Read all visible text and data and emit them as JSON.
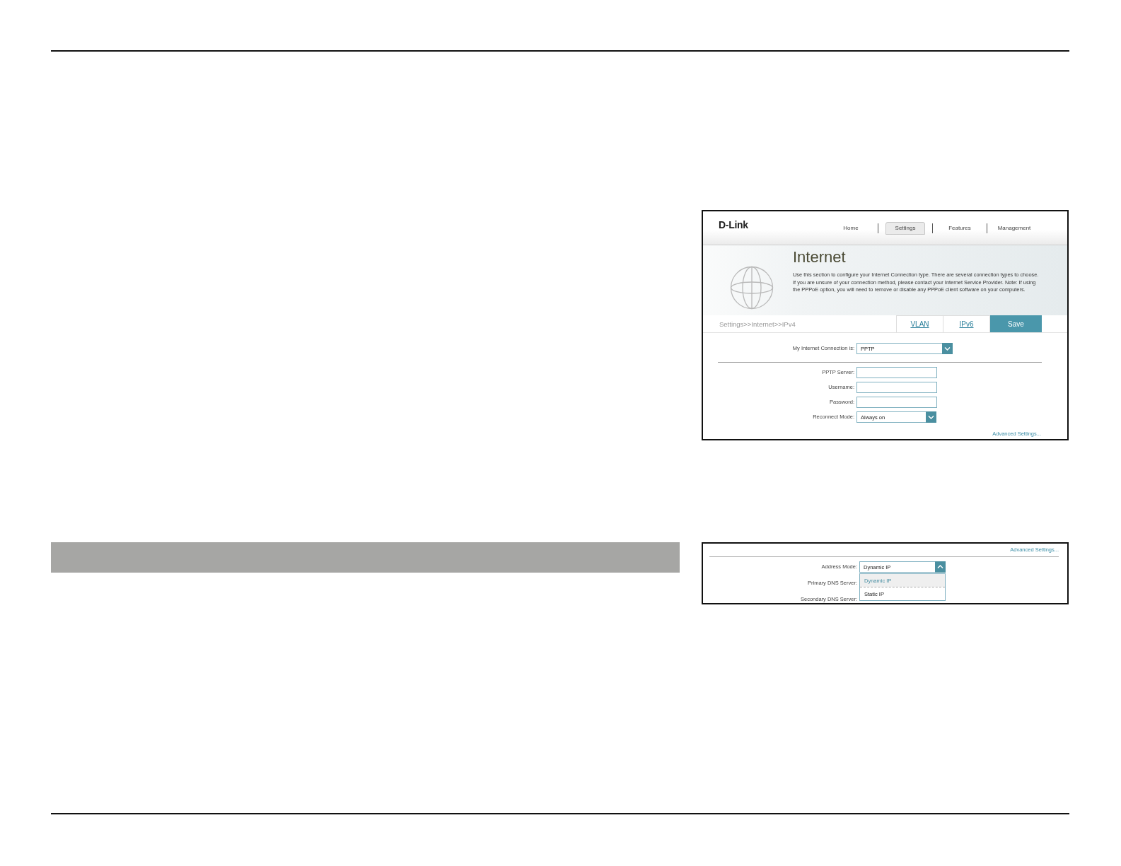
{
  "main_screenshot": {
    "logo": "D-Link",
    "nav": [
      {
        "label": "Home",
        "selected": false
      },
      {
        "label": "Settings",
        "selected": true
      },
      {
        "label": "Features",
        "selected": false
      },
      {
        "label": "Management",
        "selected": false
      }
    ],
    "hero": {
      "title": "Internet",
      "description": "Use this section to configure your Internet Connection type. There are several connection types to choose. If you are unsure of your connection method, please contact your Internet Service Provider. Note: If using the PPPoE option, you will need to remove or disable any PPPoE client software on your computers."
    },
    "breadcrumb": "Settings>>Internet>>IPv4",
    "tabs": [
      {
        "label": "VLAN",
        "kind": "link"
      },
      {
        "label": "IPv6",
        "kind": "link"
      },
      {
        "label": "Save",
        "kind": "button"
      }
    ],
    "connection": {
      "label": "My Internet Connection is:",
      "value": "PPTP"
    },
    "fields": [
      {
        "kind": "text",
        "label": "PPTP Server:"
      },
      {
        "kind": "text",
        "label": "Username:"
      },
      {
        "kind": "text",
        "label": "Password:"
      },
      {
        "kind": "select",
        "label": "Reconnect Mode:",
        "value": "Always on"
      }
    ],
    "advanced_link": "Advanced Settings..."
  },
  "dropdown_screenshot": {
    "advanced_link": "Advanced Settings...",
    "address_mode": {
      "label": "Address Mode:",
      "value": "Dynamic IP",
      "expanded": true,
      "options": [
        {
          "label": "Dynamic IP",
          "selected": true
        },
        {
          "label": "Static IP",
          "selected": false
        }
      ]
    },
    "labels": [
      "Primary DNS Server:",
      "Secondary DNS Server:"
    ]
  }
}
